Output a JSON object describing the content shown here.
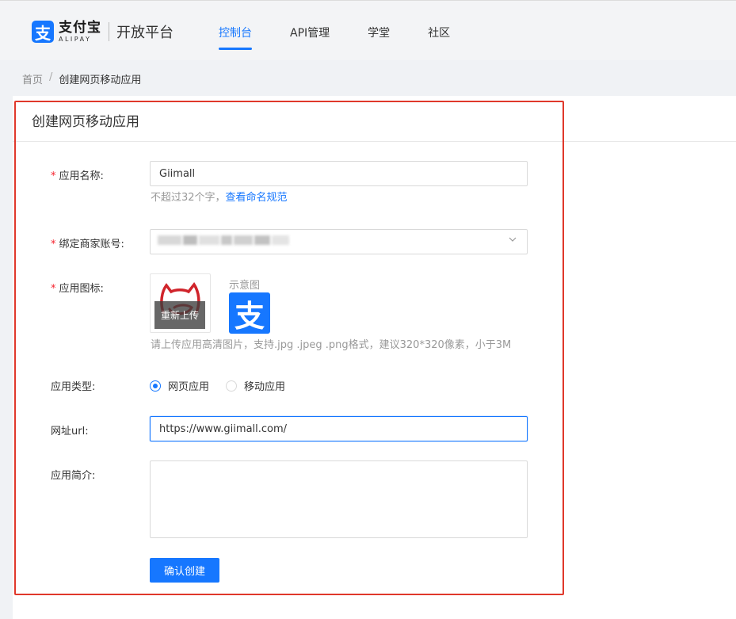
{
  "header": {
    "logo_mark": "支",
    "logo_cn": "支付宝",
    "logo_en": "ALIPAY",
    "platform": "开放平台",
    "nav": [
      {
        "label": "控制台",
        "active": true
      },
      {
        "label": "API管理",
        "active": false
      },
      {
        "label": "学堂",
        "active": false
      },
      {
        "label": "社区",
        "active": false
      }
    ]
  },
  "breadcrumb": {
    "home": "首页",
    "separator": "/",
    "current": "创建网页移动应用"
  },
  "panel": {
    "title": "创建网页移动应用"
  },
  "form": {
    "required_mark": "*",
    "app_name": {
      "label": "应用名称:",
      "value": "Giimall",
      "help": "不超过32个字，",
      "help_link": "查看命名规范"
    },
    "merchant": {
      "label": "绑定商家账号:"
    },
    "icon": {
      "label": "应用图标:",
      "reupload": "重新上传",
      "sample_label": "示意图",
      "sample_icon": "支",
      "help": "请上传应用高清图片，支持.jpg .jpeg .png格式，建议320*320像素，小于3M"
    },
    "app_type": {
      "label": "应用类型:",
      "options": [
        {
          "label": "网页应用",
          "selected": true
        },
        {
          "label": "移动应用",
          "selected": false
        }
      ]
    },
    "url": {
      "label": "网址url:",
      "value": "https://www.giimall.com/"
    },
    "intro": {
      "label": "应用简介:",
      "value": ""
    },
    "submit": "确认创建"
  },
  "colors": {
    "primary": "#1677ff",
    "required": "#f5222d",
    "highlight_border": "#e0382b"
  }
}
